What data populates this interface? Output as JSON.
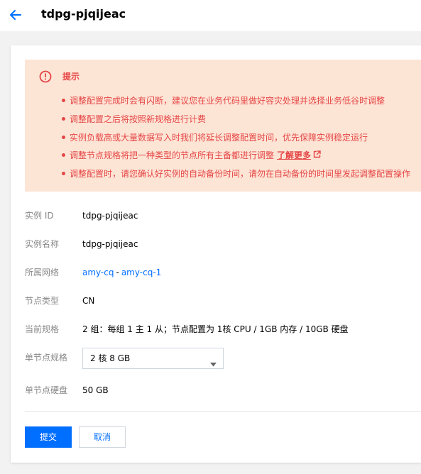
{
  "header": {
    "title": "tdpg-pjqijeac"
  },
  "notice": {
    "title": "提示",
    "items": [
      "调整配置完成时会有闪断，建议您在业务代码里做好容灾处理并选择业务低谷时调整",
      "调整配置之后将按照新规格进行计费",
      "实例负载高或大量数据写入时我们将延长调整配置时间，优先保障实例稳定运行",
      "调整节点规格将把一种类型的节点所有主备都进行调整",
      "调整配置时，请您确认好实例的自动备份时间，请勿在自动备份的时间里发起调整配置操作"
    ],
    "link_label": "了解更多"
  },
  "details": {
    "instance_id": {
      "label": "实例 ID",
      "value": "tdpg-pjqijeac"
    },
    "instance_name": {
      "label": "实例名称",
      "value": "tdpg-pjqijeac"
    },
    "network": {
      "label": "所属网络",
      "vpc": "amy-cq",
      "separator": "-",
      "subnet": "amy-cq-1"
    },
    "node_type": {
      "label": "节点类型",
      "value": "CN"
    },
    "current_spec": {
      "label": "当前规格",
      "value": "2 组：每组 1 主 1 从；节点配置为 1核 CPU / 1GB 内存 / 10GB 硬盘"
    },
    "node_spec": {
      "label": "单节点规格",
      "selected": "2 核 8 GB"
    },
    "node_disk": {
      "label": "单节点硬盘",
      "value": "50 GB"
    }
  },
  "actions": {
    "submit_label": "提交",
    "cancel_label": "取消"
  },
  "colors": {
    "accent": "#006eff",
    "warning_bg": "#fde5d6",
    "warning_text": "#e54545"
  }
}
